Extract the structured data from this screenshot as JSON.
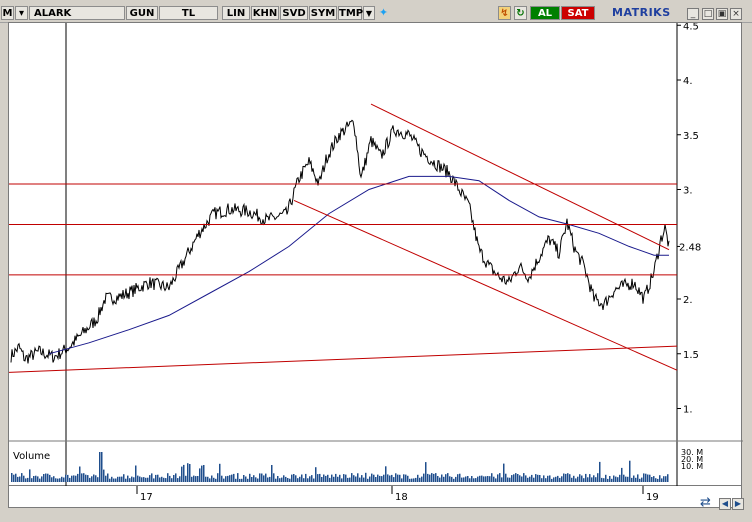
{
  "toolbar": {
    "m_label": "M",
    "symbol": "ALARK",
    "buttons": [
      "GUN",
      "TL",
      "LIN",
      "KHN",
      "SVD",
      "SYM",
      "TMP"
    ],
    "al_label": "AL",
    "sat_label": "SAT",
    "brand": "MATRIKS",
    "colors": {
      "al": "#008000",
      "sat": "#cc0000",
      "brand": "#1f3f9f"
    }
  },
  "chart_data": {
    "type": "line",
    "ylim": [
      0.7,
      4.5
    ],
    "y_ticks": [
      "4.5",
      "4.",
      "3.5",
      "3.",
      "2.5",
      "2.",
      "1.5",
      "1."
    ],
    "last_value_label": "2.48",
    "time_labels": [
      "17",
      "18",
      "19"
    ],
    "volume_label": "Volume",
    "volume_ticks": [
      "30. M",
      "20. M",
      "10. M"
    ],
    "colors": {
      "price": "#000000",
      "ma": "#1a1a8c",
      "lines": "#c00000",
      "volume": "#1f4e8c"
    }
  }
}
